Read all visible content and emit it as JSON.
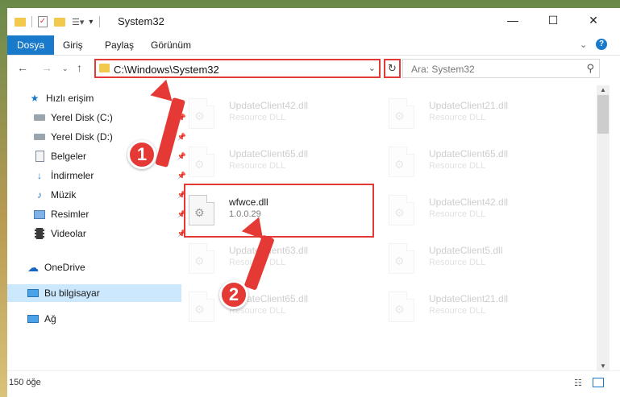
{
  "window": {
    "title": "System32",
    "controls": {
      "minimize": "—",
      "maximize": "☐",
      "close": "✕"
    }
  },
  "ribbon": {
    "tabs": [
      {
        "label": "Dosya",
        "active": true
      },
      {
        "label": "Giriş",
        "active": false
      },
      {
        "label": "Paylaş",
        "active": false
      },
      {
        "label": "Görünüm",
        "active": false
      }
    ]
  },
  "address": {
    "path": "C:\\Windows\\System32",
    "search_placeholder": "Ara: System32"
  },
  "nav": {
    "items": [
      {
        "label": "Hızlı erişim",
        "icon": "star-icon",
        "pinned": false,
        "selected": false
      },
      {
        "label": "Yerel Disk (C:)",
        "icon": "drive-icon",
        "pinned": true,
        "selected": false
      },
      {
        "label": "Yerel Disk (D:)",
        "icon": "drive-icon",
        "pinned": true,
        "selected": false
      },
      {
        "label": "Belgeler",
        "icon": "documents-icon",
        "pinned": true,
        "selected": false
      },
      {
        "label": "İndirmeler",
        "icon": "download-icon",
        "pinned": true,
        "selected": false
      },
      {
        "label": "Müzik",
        "icon": "music-icon",
        "pinned": true,
        "selected": false
      },
      {
        "label": "Resimler",
        "icon": "pictures-icon",
        "pinned": true,
        "selected": false
      },
      {
        "label": "Videolar",
        "icon": "video-icon",
        "pinned": true,
        "selected": false
      },
      {
        "label": "OneDrive",
        "icon": "cloud-icon",
        "pinned": false,
        "selected": false
      },
      {
        "label": "Bu bilgisayar",
        "icon": "computer-icon",
        "pinned": false,
        "selected": true
      },
      {
        "label": "Ağ",
        "icon": "network-icon",
        "pinned": false,
        "selected": false
      }
    ]
  },
  "files": {
    "left": [
      {
        "name": "UpdateClient42.dll",
        "desc": "Resource DLL",
        "faded": true
      },
      {
        "name": "UpdateClient65.dll",
        "desc": "Resource DLL",
        "faded": true
      },
      {
        "name": "wfwce.dll",
        "desc": "1.0.0.29",
        "faded": false
      },
      {
        "name": "UpdateClient63.dll",
        "desc": "Resource DLL",
        "faded": true
      },
      {
        "name": "UpdateClient65.dll",
        "desc": "Resource DLL",
        "faded": true
      }
    ],
    "right": [
      {
        "name": "UpdateClient21.dll",
        "desc": "Resource DLL",
        "faded": true
      },
      {
        "name": "UpdateClient65.dll",
        "desc": "Resource DLL",
        "faded": true
      },
      {
        "name": "UpdateClient42.dll",
        "desc": "Resource DLL",
        "faded": true
      },
      {
        "name": "UpdateClient5.dll",
        "desc": "Resource DLL",
        "faded": true
      },
      {
        "name": "UpdateClient21.dll",
        "desc": "Resource DLL",
        "faded": true
      }
    ]
  },
  "status": {
    "item_count": "150 öğe"
  },
  "annotations": {
    "step1": "1",
    "step2": "2"
  },
  "colors": {
    "accent": "#1979ca",
    "annotation": "#e53935",
    "selection": "#cce8ff"
  }
}
